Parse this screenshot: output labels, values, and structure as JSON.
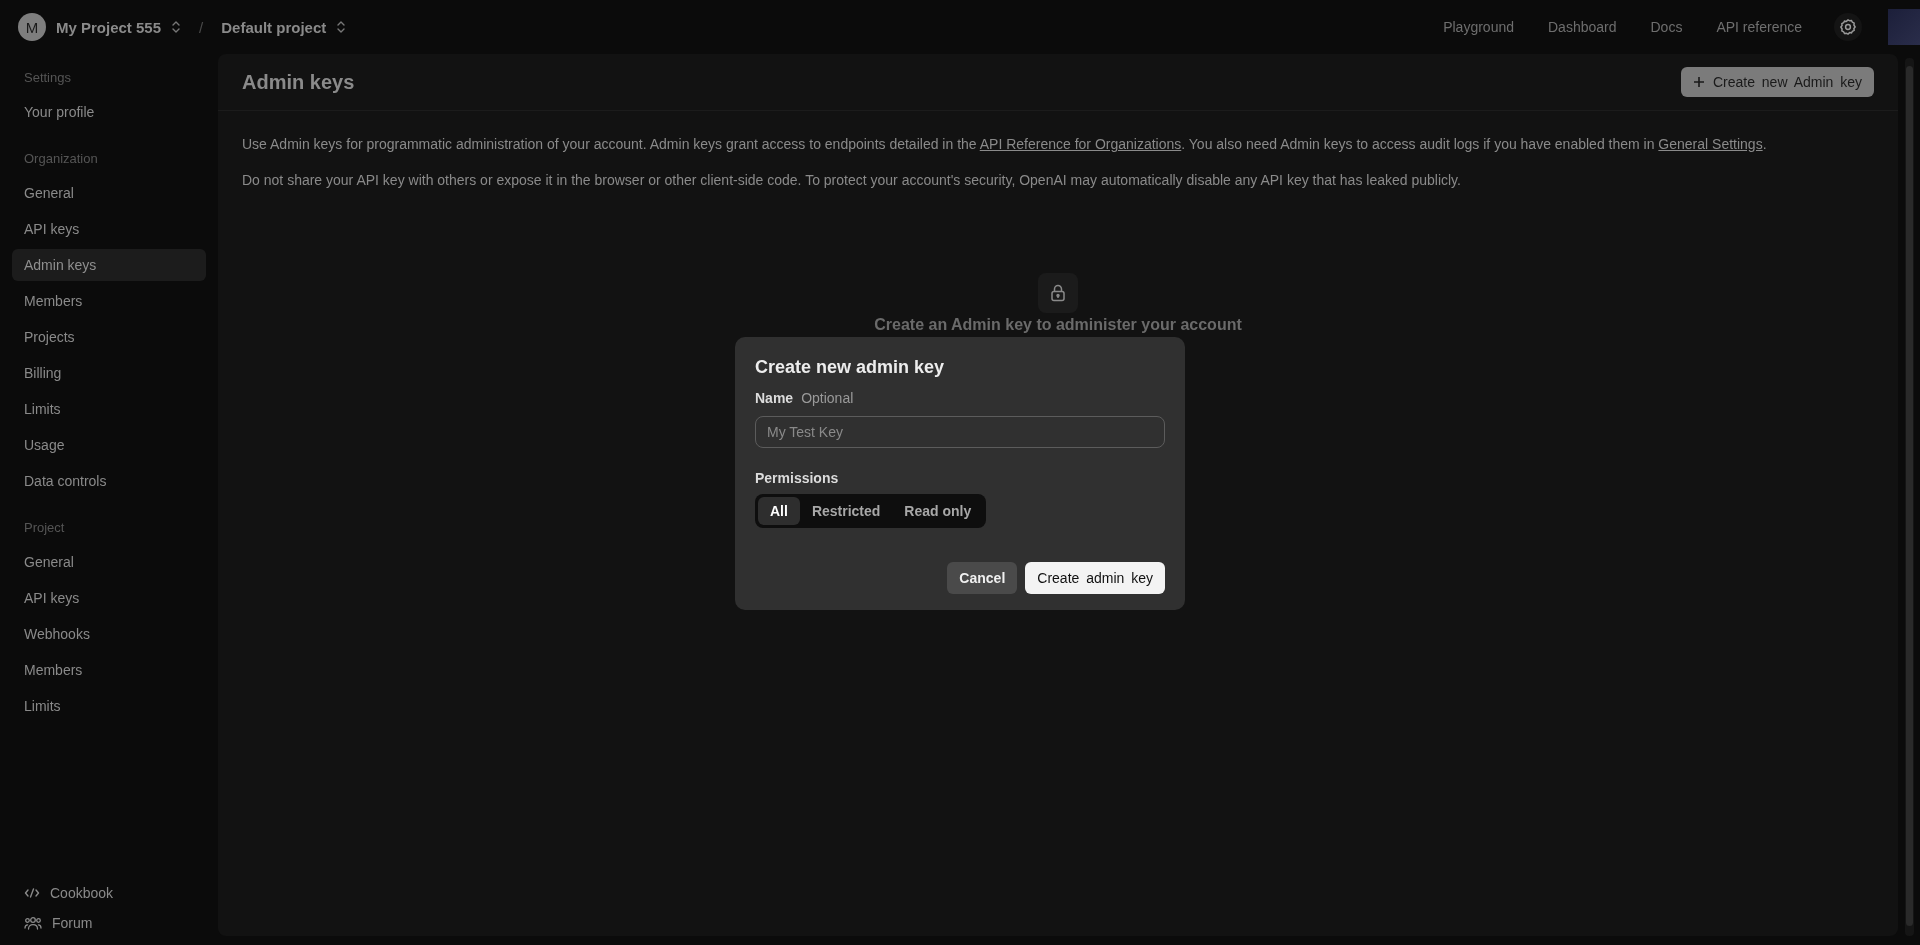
{
  "topbar": {
    "organization": {
      "initial": "M",
      "name": "My Project 555"
    },
    "separator": "/",
    "project": "Default project",
    "nav_links": [
      "Playground",
      "Dashboard",
      "Docs",
      "API reference"
    ]
  },
  "sidebar": {
    "sections": [
      {
        "title": "Settings",
        "items": [
          {
            "label": "Your profile",
            "selected": false
          }
        ]
      },
      {
        "title": "Organization",
        "items": [
          {
            "label": "General",
            "selected": false
          },
          {
            "label": "API keys",
            "selected": false
          },
          {
            "label": "Admin keys",
            "selected": true
          },
          {
            "label": "Members",
            "selected": false
          },
          {
            "label": "Projects",
            "selected": false
          },
          {
            "label": "Billing",
            "selected": false
          },
          {
            "label": "Limits",
            "selected": false
          },
          {
            "label": "Usage",
            "selected": false
          },
          {
            "label": "Data controls",
            "selected": false
          }
        ]
      },
      {
        "title": "Project",
        "items": [
          {
            "label": "General",
            "selected": false
          },
          {
            "label": "API keys",
            "selected": false
          },
          {
            "label": "Webhooks",
            "selected": false
          },
          {
            "label": "Members",
            "selected": false
          },
          {
            "label": "Limits",
            "selected": false
          }
        ]
      }
    ],
    "footer_links": [
      {
        "label": "Cookbook",
        "kind": "code"
      },
      {
        "label": "Forum",
        "kind": "people"
      }
    ]
  },
  "main": {
    "title": "Admin keys",
    "create_button": "Create new Admin key",
    "paragraphs": [
      [
        {
          "kind": "text",
          "text": "Use Admin keys for programmatic administration of your account. Admin keys grant access to endpoints detailed in the "
        },
        {
          "kind": "link",
          "text": "API Reference for Organizations"
        },
        {
          "kind": "text",
          "text": ". You also need Admin keys to access audit logs if you have enabled them in "
        },
        {
          "kind": "link",
          "text": "General Settings"
        },
        {
          "kind": "text",
          "text": "."
        }
      ],
      [
        {
          "kind": "text",
          "text": "Do not share your API key with others or expose it in the browser or other client-side code. To protect your account's security, OpenAI may automatically disable any API key that has leaked publicly."
        }
      ]
    ],
    "empty_state": {
      "message": "Create an Admin key to administer your account"
    }
  },
  "dialog": {
    "title": "Create new admin key",
    "name_label": "Name",
    "name_hint": "Optional",
    "name_field": {
      "placeholder": "My Test Key"
    },
    "permissions_label": "Permissions",
    "permissions": [
      {
        "label": "All",
        "selected": true
      },
      {
        "label": "Restricted",
        "selected": false
      },
      {
        "label": "Read only",
        "selected": false
      }
    ],
    "buttons": [
      {
        "label": "Cancel",
        "kind": "secondary"
      },
      {
        "label": "Create admin key",
        "kind": "primary"
      }
    ]
  }
}
